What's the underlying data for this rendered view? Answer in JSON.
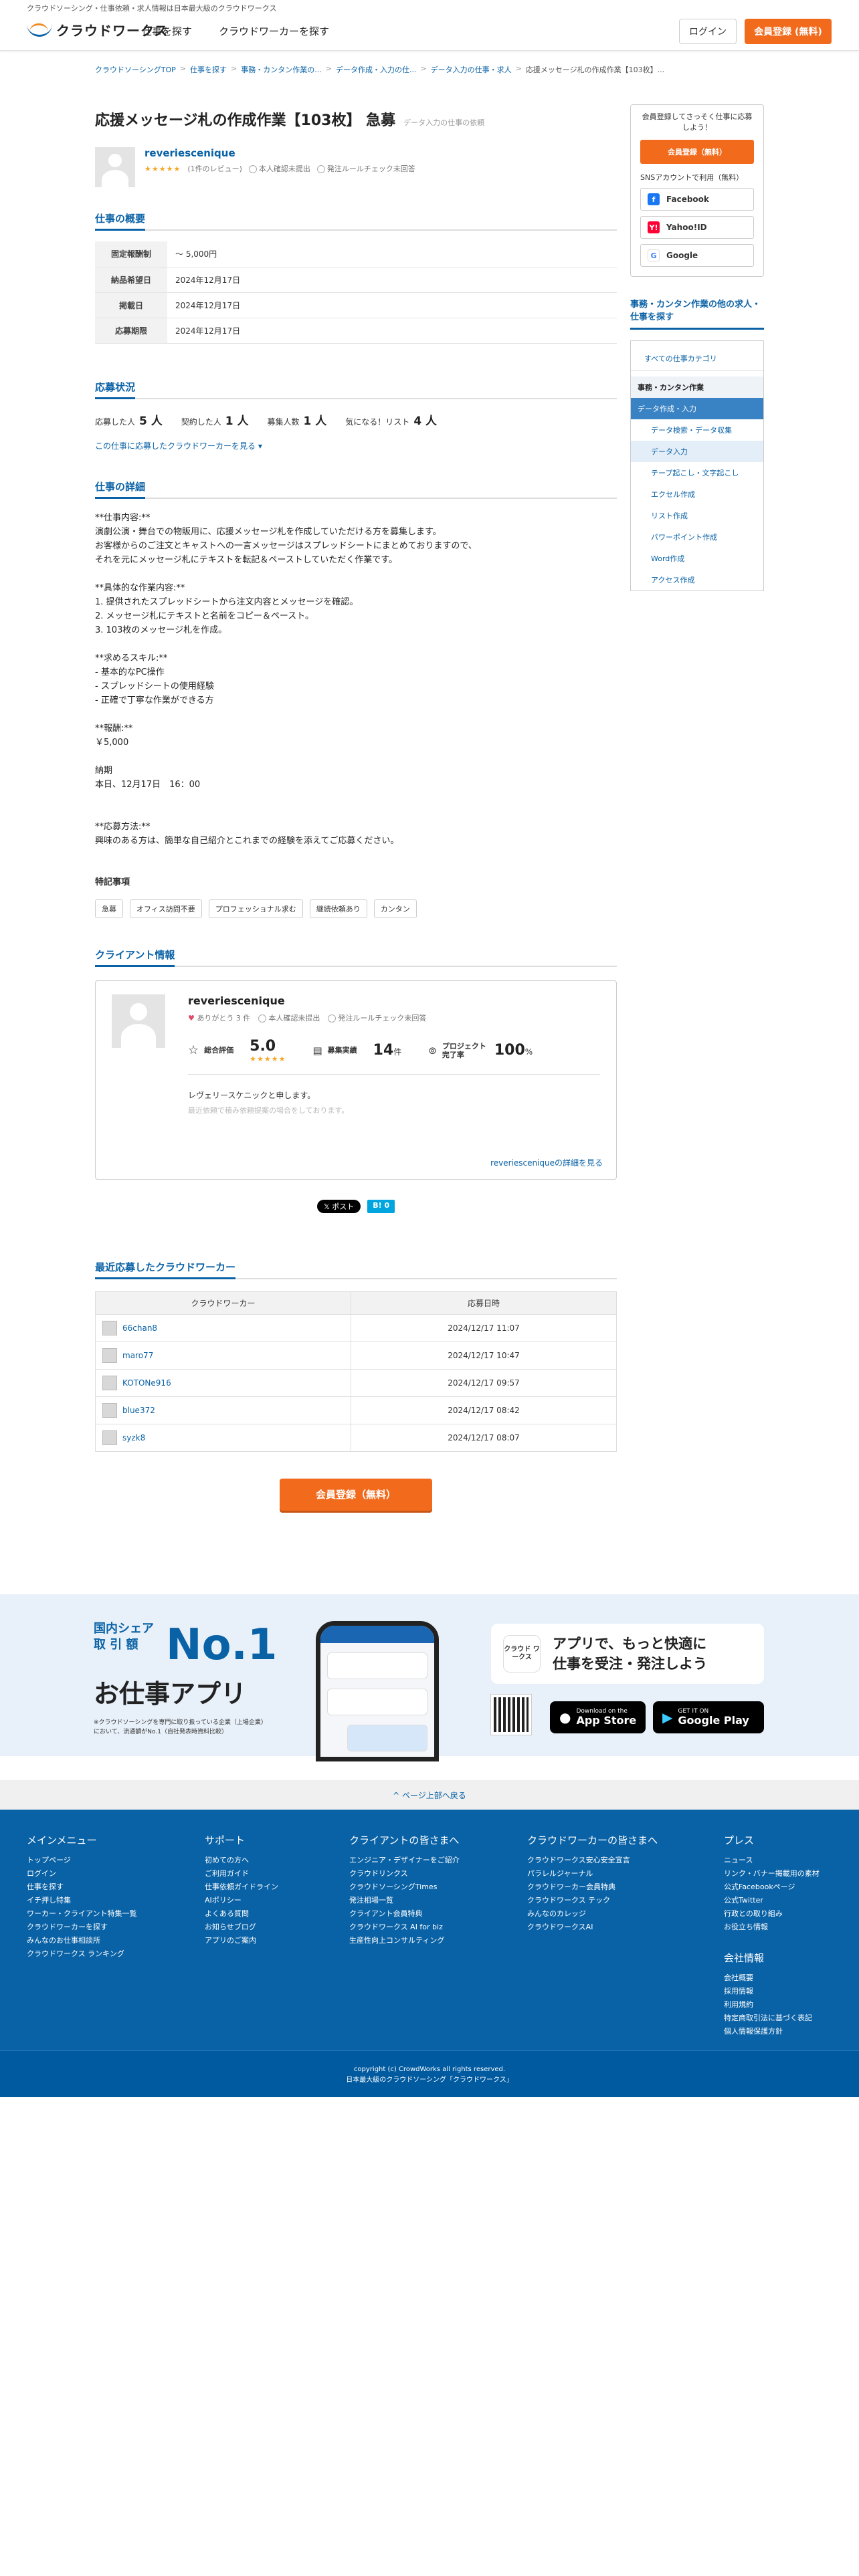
{
  "header": {
    "tagline": "クラウドソーシング・仕事依頼・求人情報は日本最大級のクラウドワークス",
    "logo_text": "クラウドワークス",
    "nav": [
      "仕事を探す",
      "クラウドワーカーを探す"
    ],
    "login": "ログイン",
    "signup": "会員登録 (無料)"
  },
  "breadcrumb": [
    "クラウドソーシングTOP",
    "仕事を探す",
    "事務・カンタン作業の...",
    "データ作成・入力の仕...",
    "データ入力の仕事・求人",
    "応援メッセージ札の作成作業【103枚】..."
  ],
  "job": {
    "title": "応援メッセージ札の作成作業【103枚】 急募",
    "title_sub": "データ入力の仕事の依頼",
    "client_name": "reveriescenique",
    "stars": "★★★★★",
    "review_count": "(1件のレビュー)",
    "identity": "本人確認未提出",
    "rule_check": "発注ルールチェック未回答"
  },
  "overview": {
    "heading": "仕事の概要",
    "rows": [
      {
        "label": "固定報酬制",
        "value": "〜 5,000円"
      },
      {
        "label": "納品希望日",
        "value": "2024年12月17日"
      },
      {
        "label": "掲載日",
        "value": "2024年12月17日"
      },
      {
        "label": "応募期限",
        "value": "2024年12月17日"
      }
    ]
  },
  "status": {
    "heading": "応募状況",
    "items": [
      {
        "label": "応募した人",
        "value": "5 人"
      },
      {
        "label": "契約した人",
        "value": "1 人"
      },
      {
        "label": "募集人数",
        "value": "1 人"
      },
      {
        "label": "気になる！リスト",
        "value": "4 人"
      }
    ],
    "link": "この仕事に応募したクラウドワーカーを見る ▾"
  },
  "detail": {
    "heading": "仕事の詳細",
    "text": "**仕事内容:**\n演劇公演・舞台での物販用に、応援メッセージ札を作成していただける方を募集します。\nお客様からのご注文とキャストへの一言メッセージはスプレッドシートにまとめておりますので、\nそれを元にメッセージ札にテキストを転記＆ペーストしていただく作業です。\n\n**具体的な作業内容:**\n1. 提供されたスプレッドシートから注文内容とメッセージを確認。\n2. メッセージ札にテキストと名前をコピー＆ペースト。\n3. 103枚のメッセージ札を作成。\n\n**求めるスキル:**\n- 基本的なPC操作\n- スプレッドシートの使用経験\n- 正確で丁寧な作業ができる方\n\n**報酬:**\n￥5,000\n\n納期\n本日、12月17日　16：00\n\n\n**応募方法:**\n興味のある方は、簡単な自己紹介とこれまでの経験を添えてご応募ください。",
    "tags_heading": "特記事項",
    "tags": [
      "急募",
      "オフィス訪問不要",
      "プロフェッショナル求む",
      "継続依頼あり",
      "カンタン"
    ]
  },
  "client": {
    "heading": "クライアント情報",
    "name": "reveriescenique",
    "thanks": "ありがとう 3 件",
    "identity": "本人確認未提出",
    "rule_check": "発注ルールチェック未回答",
    "rating_label": "総合評価",
    "rating": "5.0",
    "stars": "★★★★★",
    "jobs_label": "募集実績",
    "jobs": "14",
    "jobs_unit": "件",
    "complete_label": "プロジェクト完了率",
    "complete": "100",
    "complete_unit": "%",
    "desc": "レヴェリースケニックと申します。",
    "desc2": "最近依頼で積み依頼提案の場合をしております。",
    "link": "reveriesceniqueの詳細を見る"
  },
  "share": {
    "x": "𝕏 ポスト",
    "b": "B! 0"
  },
  "recent": {
    "heading": "最近応募したクラウドワーカー",
    "col1": "クラウドワーカー",
    "col2": "応募日時",
    "rows": [
      {
        "name": "66chan8",
        "date": "2024/12/17 11:07"
      },
      {
        "name": "maro77",
        "date": "2024/12/17 10:47"
      },
      {
        "name": "KOTONe916",
        "date": "2024/12/17 09:57"
      },
      {
        "name": "blue372",
        "date": "2024/12/17 08:42"
      },
      {
        "name": "syzk8",
        "date": "2024/12/17 08:07"
      }
    ]
  },
  "cta": "会員登録（無料）",
  "sidebar": {
    "prompt": "会員登録してさっそく仕事に応募しよう！",
    "signup": "会員登録（無料）",
    "sns_label": "SNSアカウントで利用（無料）",
    "sns": [
      {
        "label": "Facebook",
        "icon": "f",
        "color": "#1877f2"
      },
      {
        "label": "Yahoo!ID",
        "icon": "Y!",
        "color": "#ff0033"
      },
      {
        "label": "Google",
        "icon": "G",
        "color": "#4285f4"
      }
    ],
    "cat_heading": "事務・カンタン作業の他の求人・仕事を探す",
    "cat_all": "すべての仕事カテゴリ",
    "cat_parent": "事務・カンタン作業",
    "cat_active": "データ作成・入力",
    "cat_items": [
      "データ検索・データ収集",
      "データ入力",
      "テープ起こし・文字起こし",
      "エクセル作成",
      "リスト作成",
      "パワーポイント作成",
      "Word作成",
      "アクセス作成"
    ]
  },
  "banner": {
    "share": "国内シェア",
    "share2": "取 引 額",
    "no1": "No.1",
    "title": "お仕事アプリ",
    "note": "※クラウドソーシングを専門に取り扱っている企業（上場企業）において、流通額がNo.1（自社発表時資料比較）",
    "app_logo": "クラウド ワークス",
    "msg1": "アプリで、もっと快適に",
    "msg2": "仕事を受注・発注しよう",
    "appstore_small": "Download on the",
    "appstore": "App Store",
    "gplay_small": "GET IT ON",
    "gplay": "Google Play"
  },
  "to_top": "^ ページ上部へ戻る",
  "footer": {
    "cols": [
      {
        "title": "メインメニュー",
        "items": [
          "トップページ",
          "ログイン",
          "仕事を探す",
          "イチ押し特集",
          "ワーカー・クライアント特集一覧",
          "クラウドワーカーを探す",
          "みんなのお仕事相談所",
          "クラウドワークス ランキング"
        ]
      },
      {
        "title": "サポート",
        "items": [
          "初めての方へ",
          "ご利用ガイド",
          "仕事依頼ガイドライン",
          "AIポリシー",
          "よくある質問",
          "お知らせブログ",
          "アプリのご案内"
        ]
      },
      {
        "title": "クライアントの皆さまへ",
        "items": [
          "エンジニア・デザイナーをご紹介",
          "クラウドリンクス",
          "クラウドソーシングTimes",
          "発注相場一覧",
          "クライアント会員特典",
          "クラウドワークス AI for biz",
          "生産性向上コンサルティング"
        ]
      },
      {
        "title": "クラウドワーカーの皆さまへ",
        "items": [
          "クラウドワークス安心安全宣言",
          "パラレルジャーナル",
          "クラウドワーカー会員特典",
          "クラウドワークス テック",
          "みんなのカレッジ",
          "クラウドワークスAI"
        ]
      },
      {
        "title": "プレス",
        "items": [
          "ニュース",
          "リンク・バナー掲載用の素材",
          "公式Facebookページ",
          "公式Twitter",
          "行政との取り組み",
          "お役立ち情報"
        ]
      },
      {
        "title": "会社情報",
        "items": [
          "会社概要",
          "採用情報",
          "利用規約",
          "特定商取引法に基づく表記",
          "個人情報保護方針"
        ]
      }
    ],
    "copyright": "copyright (c) CrowdWorks all rights reserved.",
    "sub": "日本最大級のクラウドソーシング「クラウドワークス」"
  }
}
